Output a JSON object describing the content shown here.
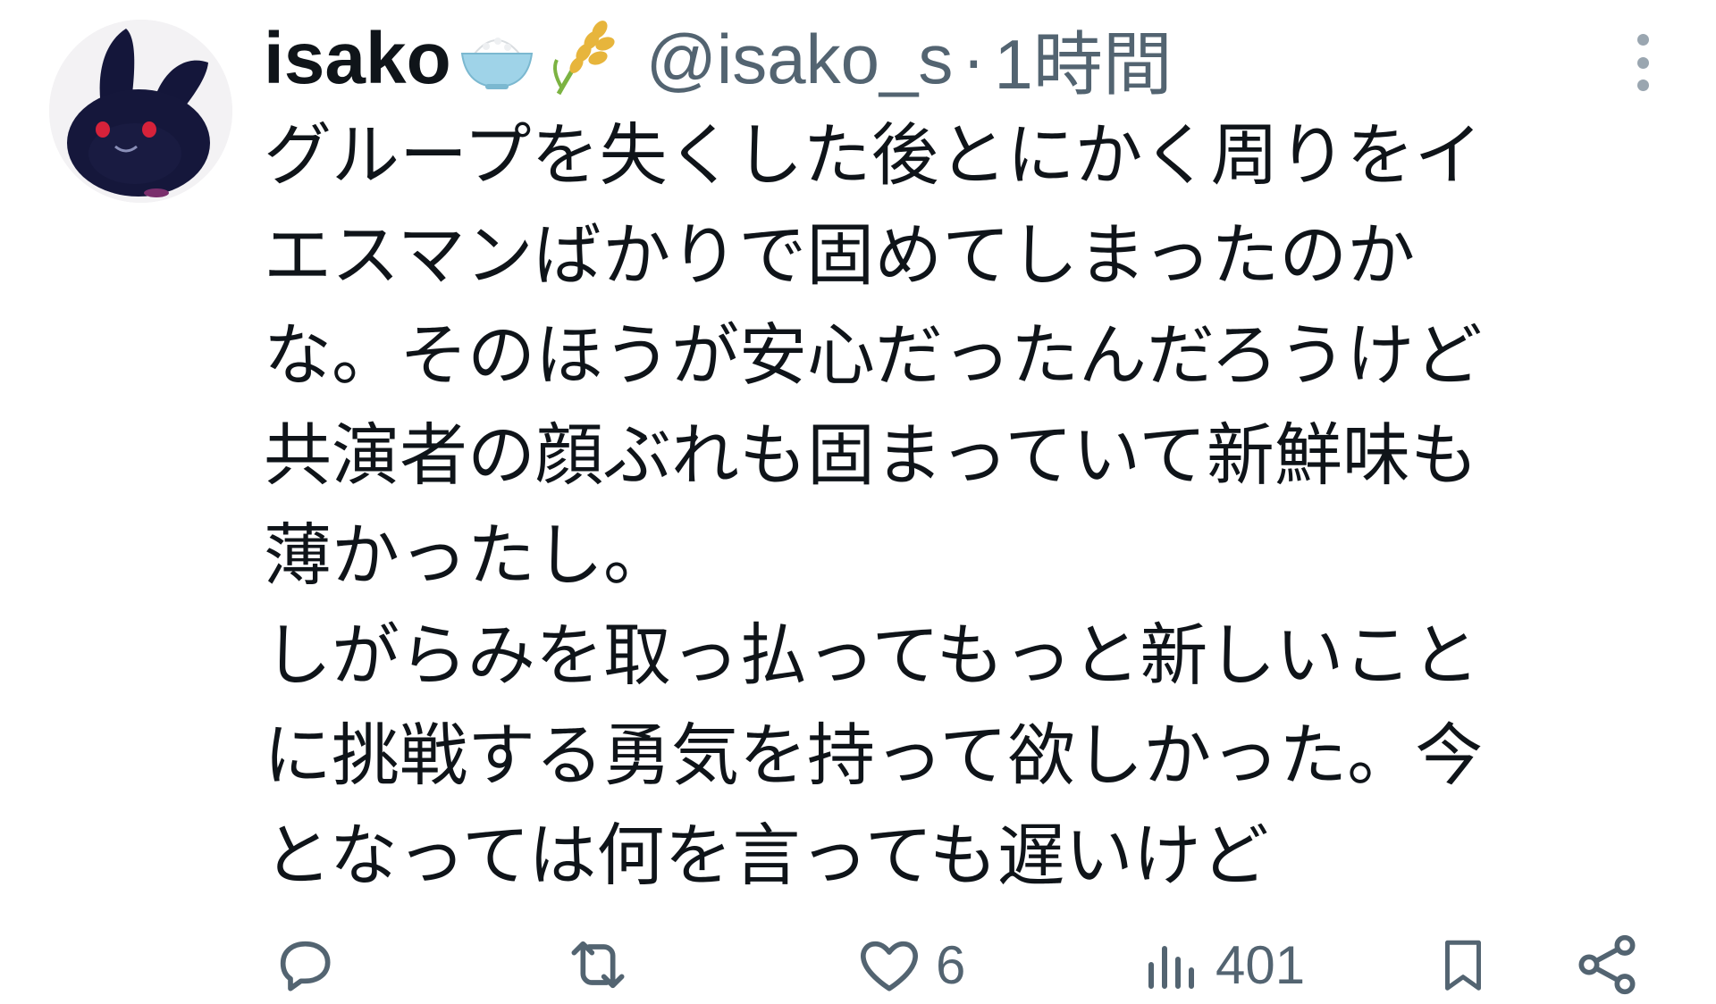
{
  "tweet": {
    "display_name": "isako",
    "name_emojis": [
      "rice-bowl-emoji",
      "rice-plant-emoji"
    ],
    "handle": "@isako_s",
    "separator": "·",
    "time": "1時間",
    "body_lines": [
      "グループを失くした後とにかく周りをイ",
      "エスマンばかりで固めてしまったのか",
      "な。そのほうが安心だったんだろうけど",
      "共演者の顔ぶれも固まっていて新鮮味も",
      "薄かったし。",
      "しがらみを取っ払ってもっと新しいこと",
      "に挑戦する勇気を持って欲しかった。今",
      "となっては何を言っても遅いけど"
    ],
    "actions": {
      "reply_icon": "reply-icon",
      "retweet_icon": "retweet-icon",
      "like_icon": "heart-icon",
      "like_count": "6",
      "views_icon": "views-chart-icon",
      "views_count": "401",
      "bookmark_icon": "bookmark-icon",
      "share_icon": "share-icon"
    },
    "colors": {
      "text": "#0f1419",
      "secondary": "#536471",
      "avatar_dark": "#14163a",
      "avatar_eyes": "#d6223a"
    }
  }
}
